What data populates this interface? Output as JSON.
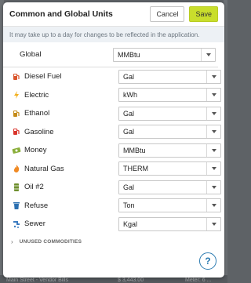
{
  "modal": {
    "title": "Common and Global Units",
    "cancel_label": "Cancel",
    "save_label": "Save",
    "notice": "It may take up to a day for changes to be reflected in the application."
  },
  "global": {
    "label": "Global",
    "value": "MMBtu"
  },
  "commodities": [
    {
      "label": "Diesel Fuel",
      "value": "Gal",
      "icon": "fuel-pump-icon",
      "color": "#d9542b"
    },
    {
      "label": "Electric",
      "value": "kWh",
      "icon": "lightning-bolt-icon",
      "color": "#f2b01e"
    },
    {
      "label": "Ethanol",
      "value": "Gal",
      "icon": "ethanol-pump-icon",
      "color": "#c48b1a"
    },
    {
      "label": "Gasoline",
      "value": "Gal",
      "icon": "gas-pump-icon",
      "color": "#d9342b"
    },
    {
      "label": "Money",
      "value": "MMBtu",
      "icon": "money-bill-icon",
      "color": "#8aae3a"
    },
    {
      "label": "Natural Gas",
      "value": "THERM",
      "icon": "flame-icon",
      "color": "#f08a24"
    },
    {
      "label": "Oil #2",
      "value": "Gal",
      "icon": "oil-barrel-icon",
      "color": "#6f8f2e"
    },
    {
      "label": "Refuse",
      "value": "Ton",
      "icon": "trash-can-icon",
      "color": "#2a6fb0"
    },
    {
      "label": "Sewer",
      "value": "Kgal",
      "icon": "sewer-icon",
      "color": "#3b7bc0"
    }
  ],
  "unused": {
    "label": "UNUSED COMMODITIES"
  },
  "help": {
    "label": "?"
  },
  "background": {
    "text_left": "Main Street - Vendor Bills",
    "text_mid": "$ 3,443.00",
    "text_right": "Meter: 6 ..."
  }
}
